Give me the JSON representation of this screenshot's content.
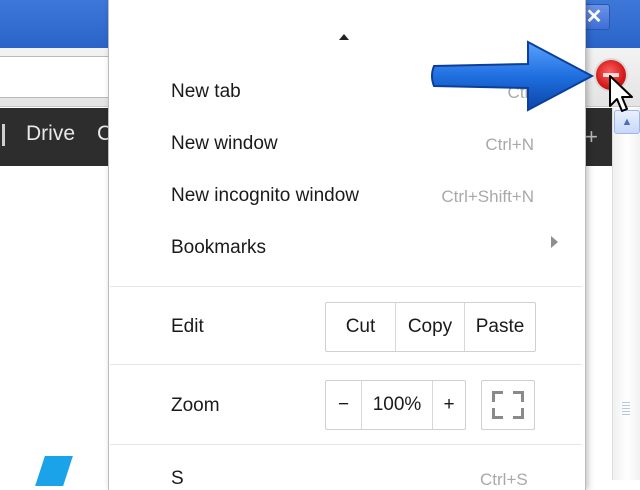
{
  "window": {
    "close_glyph": "✕"
  },
  "google_bar": {
    "items": [
      "Drive",
      "C"
    ],
    "more_glyph": "+"
  },
  "menu": {
    "items": [
      {
        "label": "New tab",
        "shortcut": "Ctrl"
      },
      {
        "label": "New window",
        "shortcut": "Ctrl+N"
      },
      {
        "label": "New incognito window",
        "shortcut": "Ctrl+Shift+N"
      },
      {
        "label": "Bookmarks",
        "shortcut": ""
      }
    ],
    "edit": {
      "label": "Edit",
      "cut": "Cut",
      "copy": "Copy",
      "paste": "Paste"
    },
    "zoom": {
      "label": "Zoom",
      "minus": "−",
      "level": "100%",
      "plus": "+"
    },
    "partial": {
      "label": "S",
      "shortcut": "Ctrl+S"
    }
  },
  "colors": {
    "accent_arrow": "#1f6fe0",
    "menu_button_red": "#d41a1a",
    "title_bar": "#2a64c9"
  },
  "icons": [
    "close-icon",
    "chrome-menu-icon",
    "submenu-arrow-icon",
    "fullscreen-icon",
    "scroll-up-icon",
    "mouse-cursor-icon",
    "pointer-arrow-icon"
  ]
}
